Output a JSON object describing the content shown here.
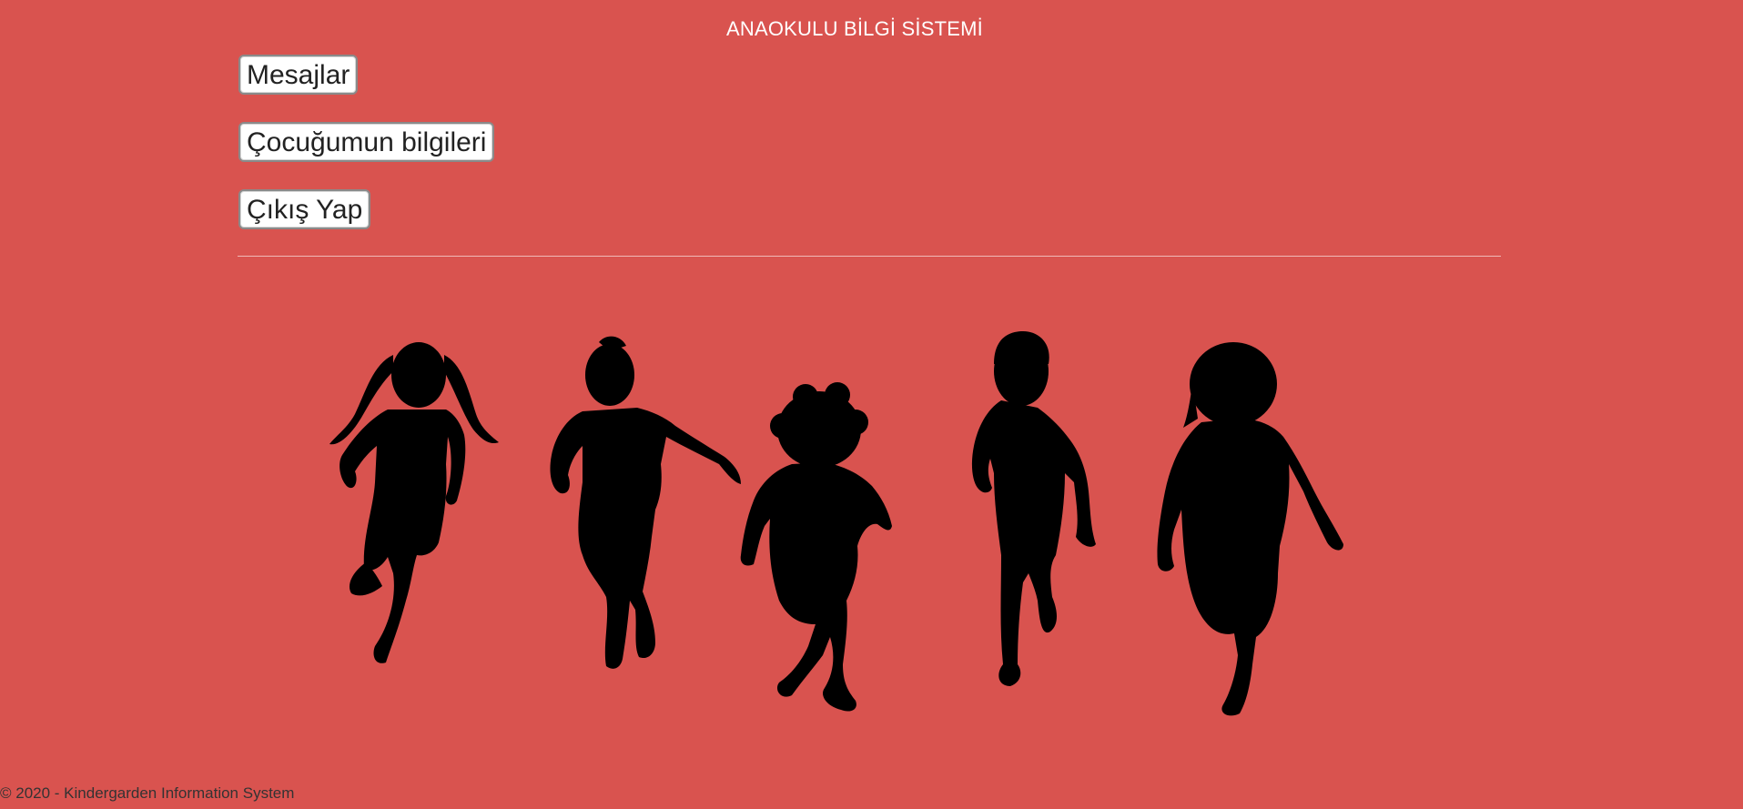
{
  "header": {
    "title": "ANAOKULU BİLGİ SİSTEMİ"
  },
  "nav": {
    "messages_label": "Mesajlar",
    "child_info_label": "Çocuğumun bilgileri",
    "logout_label": "Çıkış Yap"
  },
  "footer": {
    "copyright": "© 2020 - Kindergarden Information System"
  },
  "theme": {
    "background": "#d9534f",
    "title_color": "#ffffff",
    "silhouette_color": "#000000"
  },
  "hero": {
    "icon": "running-children-silhouettes"
  }
}
